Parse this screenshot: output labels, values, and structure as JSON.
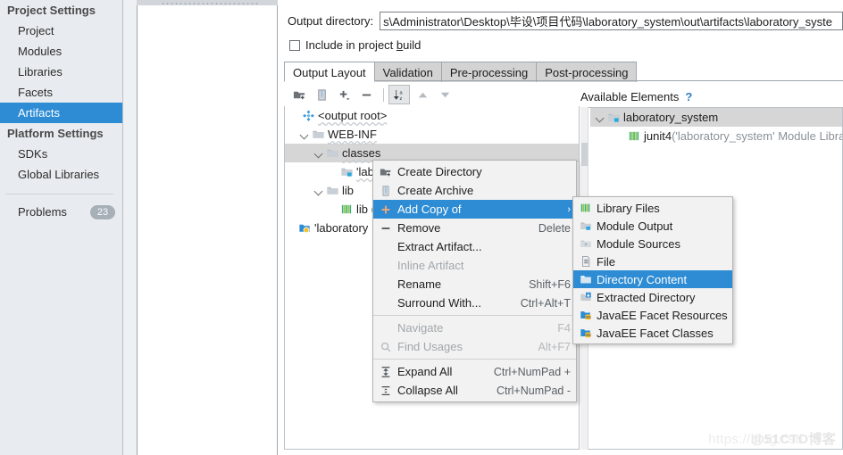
{
  "sidebar": {
    "project_settings_title": "Project Settings",
    "project_items": [
      {
        "label": "Project"
      },
      {
        "label": "Modules"
      },
      {
        "label": "Libraries"
      },
      {
        "label": "Facets"
      },
      {
        "label": "Artifacts"
      }
    ],
    "platform_settings_title": "Platform Settings",
    "platform_items": [
      {
        "label": "SDKs"
      },
      {
        "label": "Global Libraries"
      }
    ],
    "problems_label": "Problems",
    "problems_count": "23",
    "selected": "Artifacts",
    "selected_color": "#2d8cd4"
  },
  "output": {
    "directory_label": "Output directory:",
    "directory_value": "s\\Administrator\\Desktop\\毕设\\项目代码\\laboratory_system\\out\\artifacts\\laboratory_syste",
    "include_in_build_label_pre": "Include in project ",
    "include_in_build_label_accel": "b",
    "include_in_build_label_post": "uild",
    "include_in_build_checked": false
  },
  "tabs": [
    {
      "label": "Output Layout",
      "active": true
    },
    {
      "label": "Validation",
      "active": false
    },
    {
      "label": "Pre-processing",
      "active": false
    },
    {
      "label": "Post-processing",
      "active": false
    }
  ],
  "tree_toolbar": [
    {
      "icon": "create-directory-icon"
    },
    {
      "icon": "create-archive-icon"
    },
    {
      "icon": "add-copy-icon"
    },
    {
      "icon": "remove-icon"
    },
    {
      "icon": "sort-alphabetically-icon"
    },
    {
      "icon": "move-up-icon"
    },
    {
      "icon": "move-down-icon"
    }
  ],
  "output_tree": {
    "rows": [
      {
        "label": "<output root>",
        "icon": "artifact-root-icon",
        "indent": 0,
        "twisty": "none",
        "selected": false,
        "wavy": true
      },
      {
        "label": "WEB-INF",
        "icon": "folder-icon",
        "indent": 1,
        "twisty": "open",
        "selected": false,
        "wavy": true
      },
      {
        "label": "classes",
        "icon": "folder-icon",
        "indent": 2,
        "twisty": "open",
        "selected": true,
        "wavy": true
      },
      {
        "label": "'labo",
        "icon": "module-output-icon",
        "indent": 4,
        "twisty": "none",
        "selected": false,
        "wavy": true
      },
      {
        "label": "lib",
        "icon": "folder-icon",
        "indent": 2,
        "twisty": "open",
        "selected": false,
        "wavy": false
      },
      {
        "label": "lib (",
        "icon": "library-files-icon",
        "indent": 4,
        "twisty": "none",
        "selected": false,
        "wavy": false
      },
      {
        "label": "'laboratory",
        "icon": "facet-resources-icon",
        "indent": 1,
        "twisty": "none",
        "selected": false,
        "wavy": false
      }
    ]
  },
  "available": {
    "title": "Available Elements",
    "help_glyph": "?",
    "rows": [
      {
        "label": "laboratory_system",
        "icon": "module-output-icon",
        "indent": 0,
        "twisty": "open",
        "selected": true,
        "suffix": ""
      },
      {
        "label": "junit4",
        "icon": "library-files-icon",
        "indent": 2,
        "twisty": "none",
        "selected": false,
        "suffix": " ('laboratory_system' Module Libra"
      }
    ]
  },
  "context_menu": {
    "items": [
      {
        "label": "Create Directory",
        "shortcut": "",
        "icon": "create-directory-icon",
        "state": "normal",
        "submenu": false
      },
      {
        "label": "Create Archive",
        "shortcut": "",
        "icon": "create-archive-icon",
        "state": "normal",
        "submenu": false
      },
      {
        "label": "Add Copy of",
        "shortcut": "",
        "icon": "add-copy-icon",
        "state": "highlighted",
        "submenu": true
      },
      {
        "label": "Remove",
        "shortcut": "Delete",
        "icon": "remove-icon",
        "state": "normal",
        "submenu": false
      },
      {
        "label": "Extract Artifact...",
        "shortcut": "",
        "icon": "none",
        "state": "normal",
        "submenu": false
      },
      {
        "label": "Inline Artifact",
        "shortcut": "",
        "icon": "none",
        "state": "disabled",
        "submenu": false
      },
      {
        "label": "Rename",
        "shortcut": "Shift+F6",
        "icon": "none",
        "state": "normal",
        "submenu": false
      },
      {
        "label": "Surround With...",
        "shortcut": "Ctrl+Alt+T",
        "icon": "none",
        "state": "normal",
        "submenu": false
      },
      {
        "separator": true
      },
      {
        "label": "Navigate",
        "shortcut": "F4",
        "icon": "none",
        "state": "disabled",
        "submenu": false
      },
      {
        "label": "Find Usages",
        "shortcut": "Alt+F7",
        "icon": "find-usages-icon",
        "state": "disabled",
        "submenu": false
      },
      {
        "separator": true
      },
      {
        "label": "Expand All",
        "shortcut": "Ctrl+NumPad +",
        "icon": "expand-all-icon",
        "state": "normal",
        "submenu": false
      },
      {
        "label": "Collapse All",
        "shortcut": "Ctrl+NumPad -",
        "icon": "collapse-all-icon",
        "state": "normal",
        "submenu": false
      }
    ],
    "highlight_color": "#2d8cd4",
    "arrow_glyph": "›"
  },
  "submenu": {
    "items": [
      {
        "label": "Library Files",
        "icon": "library-files-icon",
        "state": "normal"
      },
      {
        "label": "Module Output",
        "icon": "module-output-icon",
        "state": "normal"
      },
      {
        "label": "Module Sources",
        "icon": "module-sources-icon",
        "state": "normal"
      },
      {
        "label": "File",
        "icon": "file-icon",
        "state": "normal"
      },
      {
        "label": "Directory Content",
        "icon": "directory-content-icon",
        "state": "highlighted"
      },
      {
        "label": "Extracted Directory",
        "icon": "extracted-directory-icon",
        "state": "normal"
      },
      {
        "label": "JavaEE Facet Resources",
        "icon": "facet-resources-icon",
        "state": "normal"
      },
      {
        "label": "JavaEE Facet Classes",
        "icon": "facet-classes-icon",
        "state": "normal"
      }
    ]
  },
  "watermark": {
    "text_left": "https://blog.csd",
    "text_right": "@51CTO博客"
  }
}
